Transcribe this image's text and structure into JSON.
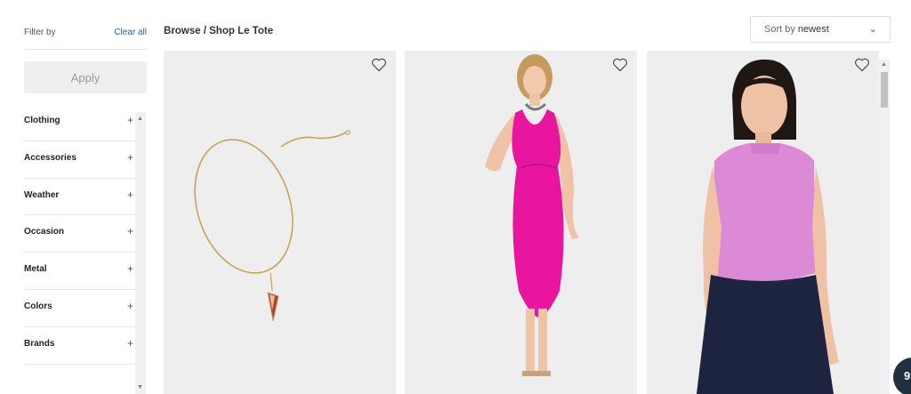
{
  "sidebar": {
    "filter_by": "Filter by",
    "clear_all": "Clear all",
    "apply": "Apply",
    "categories": [
      {
        "label": "Clothing",
        "icon": "+"
      },
      {
        "label": "Accessories",
        "icon": "+"
      },
      {
        "label": "Weather",
        "icon": "+"
      },
      {
        "label": "Occasion",
        "icon": "+"
      },
      {
        "label": "Metal",
        "icon": "+"
      },
      {
        "label": "Colors",
        "icon": "+"
      },
      {
        "label": "Brands",
        "icon": "+"
      }
    ]
  },
  "header": {
    "breadcrumb": "Browse / Shop Le Tote",
    "sort_prefix": "Sort by ",
    "sort_value": "newest",
    "sort_chevron": "⌄"
  },
  "products": [
    {
      "kind": "necklace",
      "favorite_icon": "heart-outline-icon"
    },
    {
      "kind": "pink-dress",
      "favorite_icon": "heart-outline-icon"
    },
    {
      "kind": "pink-top-navy-skirt",
      "favorite_icon": "heart-outline-icon"
    }
  ],
  "chat": {
    "label": "9"
  },
  "colors": {
    "product_bg": "#eeeeee",
    "link": "#2f5f8a",
    "dress_pink": "#e8169e",
    "top_pink": "#dd8ad6",
    "skirt_navy": "#1d2440"
  }
}
